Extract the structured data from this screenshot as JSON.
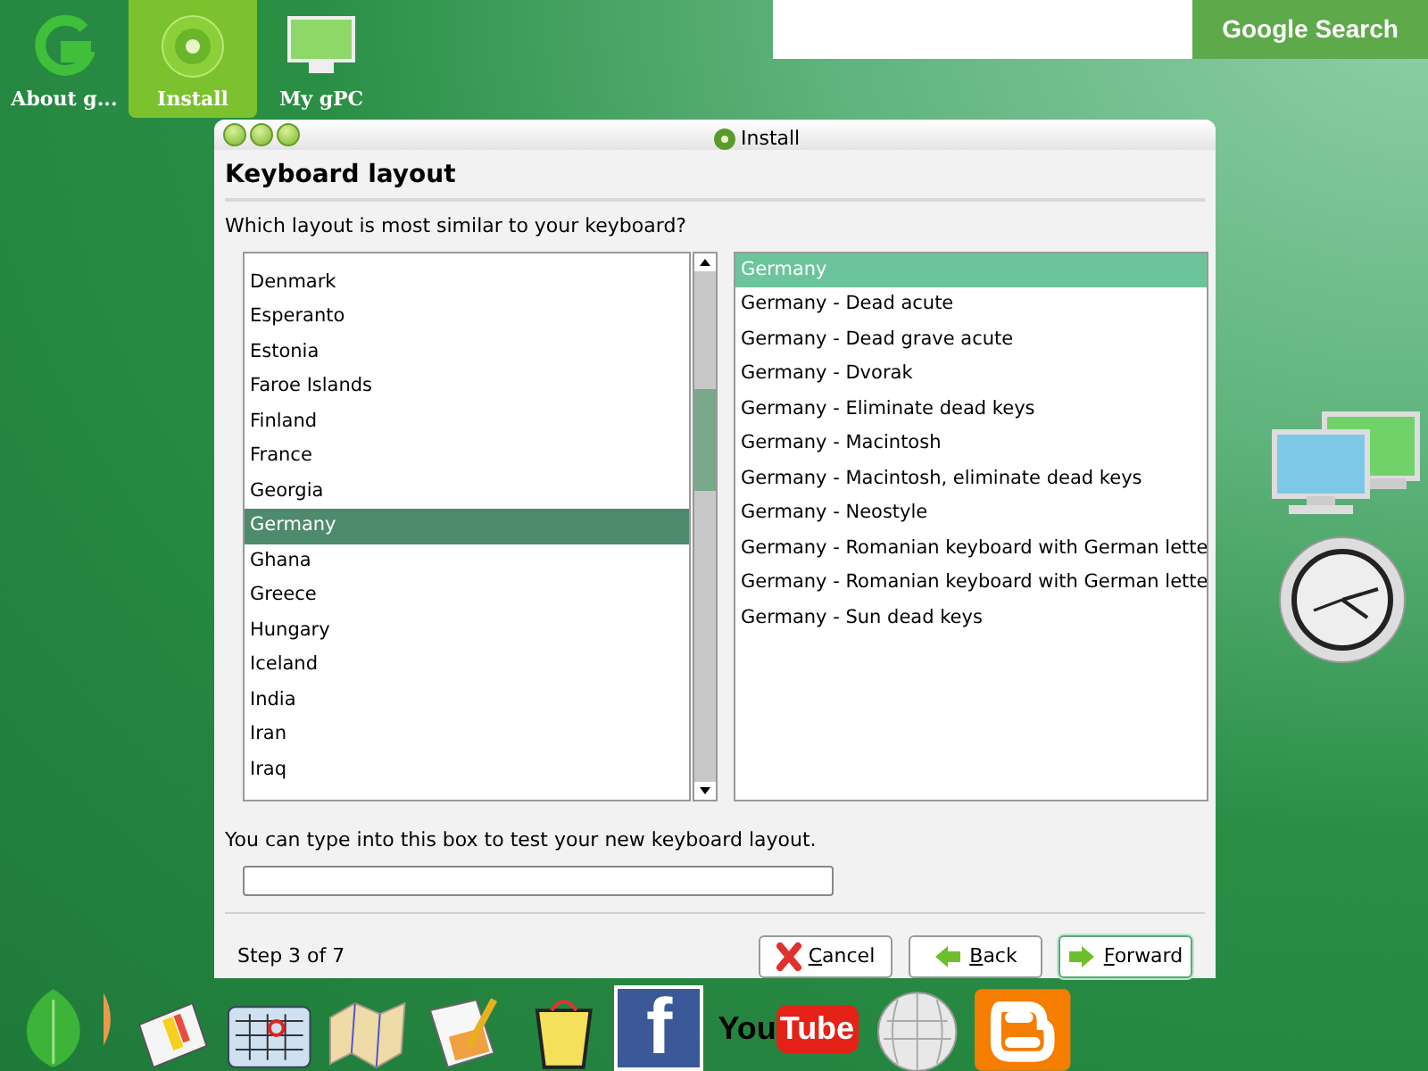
{
  "desktop_icons": [
    {
      "label": "About g...",
      "kind": "g",
      "selected": false
    },
    {
      "label": "Install",
      "kind": "disc",
      "selected": true
    },
    {
      "label": "My gPC",
      "kind": "monitor",
      "selected": false
    }
  ],
  "search": {
    "button": "Google Search"
  },
  "window": {
    "title": "Install",
    "heading": "Keyboard layout",
    "question": "Which layout is most similar to your keyboard?",
    "layouts": [
      {
        "label": "Denmark",
        "selected": false
      },
      {
        "label": "Esperanto",
        "selected": false
      },
      {
        "label": "Estonia",
        "selected": false
      },
      {
        "label": "Faroe Islands",
        "selected": false
      },
      {
        "label": "Finland",
        "selected": false
      },
      {
        "label": "France",
        "selected": false
      },
      {
        "label": "Georgia",
        "selected": false
      },
      {
        "label": "Germany",
        "selected": true
      },
      {
        "label": "Ghana",
        "selected": false
      },
      {
        "label": "Greece",
        "selected": false
      },
      {
        "label": "Hungary",
        "selected": false
      },
      {
        "label": "Iceland",
        "selected": false
      },
      {
        "label": "India",
        "selected": false
      },
      {
        "label": "Iran",
        "selected": false
      },
      {
        "label": "Iraq",
        "selected": false
      }
    ],
    "variants": [
      {
        "label": "Germany",
        "selected": true
      },
      {
        "label": "Germany - Dead acute",
        "selected": false
      },
      {
        "label": "Germany - Dead grave acute",
        "selected": false
      },
      {
        "label": "Germany - Dvorak",
        "selected": false
      },
      {
        "label": "Germany - Eliminate dead keys",
        "selected": false
      },
      {
        "label": "Germany - Macintosh",
        "selected": false
      },
      {
        "label": "Germany - Macintosh, eliminate dead keys",
        "selected": false
      },
      {
        "label": "Germany - Neostyle",
        "selected": false
      },
      {
        "label": "Germany - Romanian keyboard with German lette",
        "selected": false
      },
      {
        "label": "Germany - Romanian keyboard with German lette",
        "selected": false
      },
      {
        "label": "Germany - Sun dead keys",
        "selected": false
      }
    ],
    "test_hint": "You can type into this box to test your new keyboard layout.",
    "step": "Step 3 of 7",
    "buttons": [
      {
        "label": "Cancel",
        "kind": "cancel",
        "default": false
      },
      {
        "label": "Back",
        "kind": "back",
        "default": false
      },
      {
        "label": "Forward",
        "kind": "forward",
        "default": true
      }
    ]
  },
  "dock": {
    "facebook": "f",
    "youtube": [
      "You",
      "Tube"
    ]
  }
}
